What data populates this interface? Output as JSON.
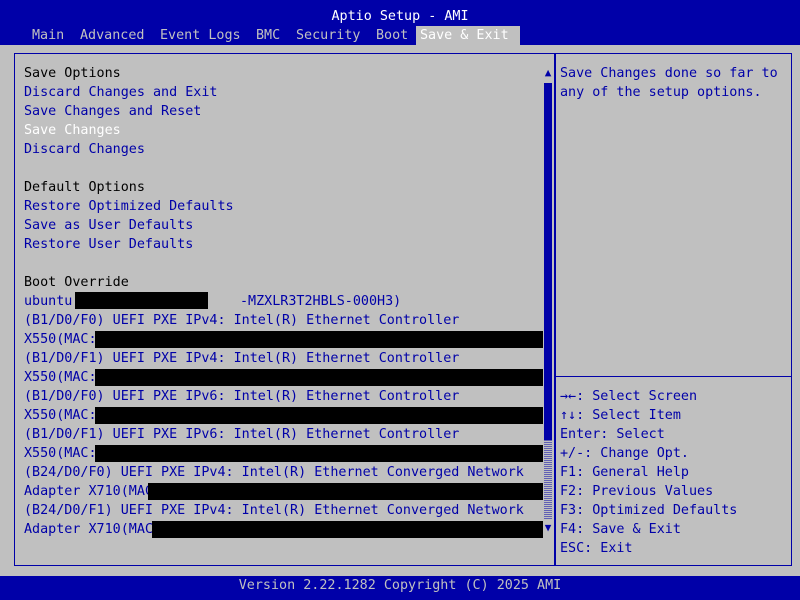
{
  "header": {
    "title": "Aptio Setup - AMI",
    "tabs": [
      "Main",
      "Advanced",
      "Event Logs",
      "BMC",
      "Security",
      "Boot",
      "Save & Exit"
    ],
    "active_tab": "Save & Exit"
  },
  "left": {
    "save_options_header": "Save Options",
    "save_items": [
      "Discard Changes and Exit",
      "Save Changes and Reset",
      "Save Changes",
      "Discard Changes"
    ],
    "default_options_header": "Default Options",
    "default_items": [
      "Restore Optimized Defaults",
      "Save as User Defaults",
      "Restore User Defaults"
    ],
    "boot_override_header": "Boot Override",
    "boot_items": [
      "ubuntu",
      "-MZXLR3T2HBLS-000H3)",
      "(B1/D0/F0) UEFI PXE IPv4: Intel(R) Ethernet Controller",
      "X550(MAC:",
      "(B1/D0/F1) UEFI PXE IPv4: Intel(R) Ethernet Controller",
      "X550(MAC:",
      "(B1/D0/F0) UEFI PXE IPv6: Intel(R) Ethernet Controller",
      "X550(MAC:",
      "(B1/D0/F1) UEFI PXE IPv6: Intel(R) Ethernet Controller",
      "X550(MAC:",
      "(B24/D0/F0) UEFI PXE IPv4: Intel(R) Ethernet Converged Network",
      "Adapter X710(MAC",
      "(B24/D0/F1) UEFI PXE IPv4: Intel(R) Ethernet Converged Network",
      "Adapter X710(MAC"
    ]
  },
  "help": {
    "description": [
      "Save Changes done so far to",
      "any of the setup options."
    ],
    "keys": [
      "→←: Select Screen",
      "↑↓: Select Item",
      "Enter: Select",
      "+/-: Change Opt.",
      "F1: General Help",
      "F2: Previous Values",
      "F3: Optimized Defaults",
      "F4: Save & Exit",
      "ESC: Exit"
    ]
  },
  "footer": "Version 2.22.1282 Copyright (C) 2025 AMI",
  "colors": {
    "blue": "#0000a8",
    "gray": "#c0c0c0",
    "white": "#ffffff",
    "black": "#000000"
  }
}
